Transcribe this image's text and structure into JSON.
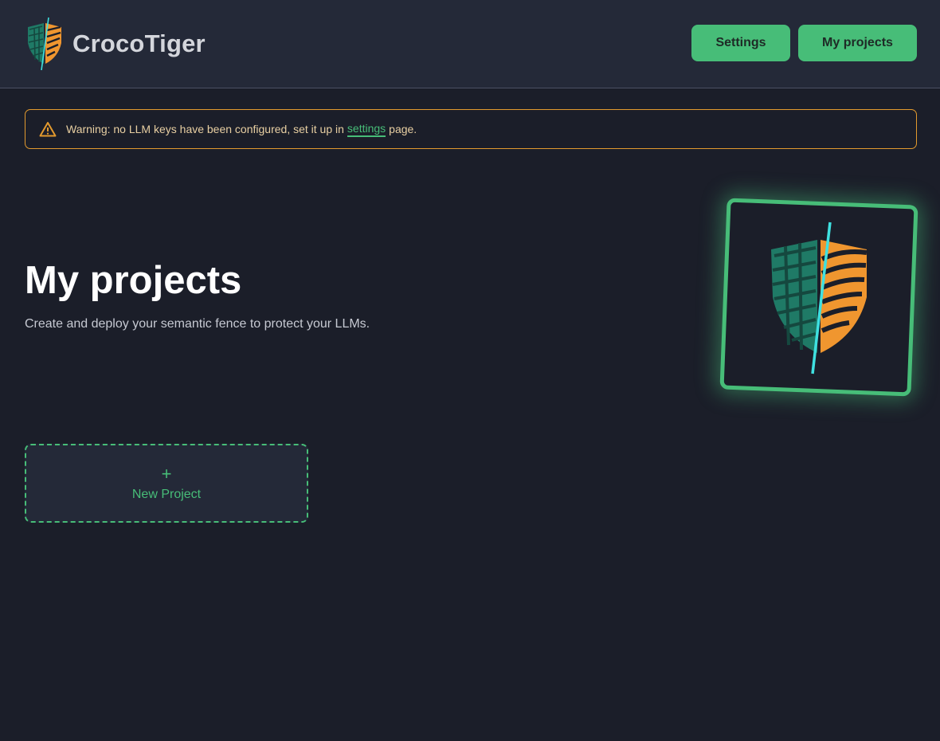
{
  "header": {
    "brand_name": "CrocoTiger",
    "nav": {
      "settings_label": "Settings",
      "projects_label": "My projects"
    }
  },
  "warning": {
    "prefix": "Warning: no LLM keys have been configured, set it up in",
    "link_label": "settings",
    "suffix": "page.",
    "icon": "warning-triangle-icon"
  },
  "hero": {
    "title": "My projects",
    "subtitle": "Create and deploy your semantic fence to protect your LLMs."
  },
  "new_project": {
    "icon": "plus-icon",
    "plus": "+",
    "label": "New Project"
  },
  "colors": {
    "background": "#1b1e29",
    "header": "#242938",
    "accent": "#47bd78",
    "warning": "#e39a2e",
    "croc": "#1f7a66",
    "tiger": "#f0962f",
    "divider": "#3fe0e0"
  }
}
